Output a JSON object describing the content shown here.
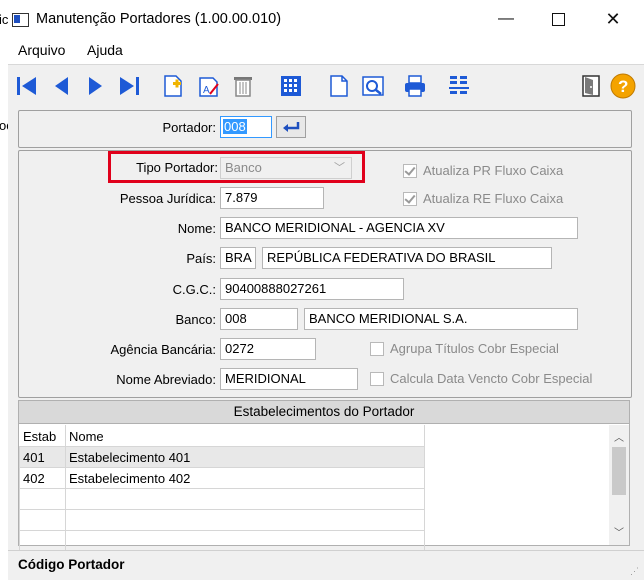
{
  "window": {
    "title": "Manutenção Portadores (1.00.00.010)"
  },
  "menu": [
    "Arquivo",
    "Ajuda"
  ],
  "toolbar": {
    "icons": [
      "first-icon",
      "previous-icon",
      "next-icon",
      "last-icon",
      "new-icon",
      "edit-icon",
      "delete-icon",
      "calculator-icon",
      "blank-page-icon",
      "preview-icon",
      "print-icon",
      "list-icon",
      "exit-door-icon",
      "help-icon"
    ]
  },
  "header": {
    "portador_label": "Portador:",
    "portador_value": "008"
  },
  "form": {
    "tipo_label": "Tipo Portador:",
    "tipo_value": "Banco",
    "pessoa_label": "Pessoa Jurídica:",
    "pessoa_value": "7.879",
    "nome_label": "Nome:",
    "nome_value": "BANCO MERIDIONAL - AGENCIA XV",
    "pais_label": "País:",
    "pais_code": "BRA",
    "pais_name": "REPÚBLICA FEDERATIVA DO BRASIL",
    "cgc_label": "C.G.C.:",
    "cgc_value": "90400888027261",
    "banco_label": "Banco:",
    "banco_code": "008",
    "banco_name": "BANCO MERIDIONAL S.A.",
    "agencia_label": "Agência Bancária:",
    "agencia_value": "0272",
    "abrev_label": "Nome Abreviado:",
    "abrev_value": "MERIDIONAL",
    "chk_pr": "Atualiza PR Fluxo Caixa",
    "chk_re": "Atualiza RE Fluxo Caixa",
    "chk_agrupa": "Agrupa Títulos Cobr Especial",
    "chk_calcula": "Calcula Data Vencto Cobr Especial"
  },
  "grid": {
    "title": "Estabelecimentos do Portador",
    "columns": [
      "Estab",
      "Nome"
    ],
    "rows": [
      [
        "401",
        "Estabelecimento 401"
      ],
      [
        "402",
        "Estabelecimento 402"
      ]
    ]
  },
  "status": "Código Portador",
  "background_fragments": [
    "ic",
    "oc"
  ],
  "colors": {
    "highlight": "#e0001b",
    "accent": "#1e5ad6"
  }
}
